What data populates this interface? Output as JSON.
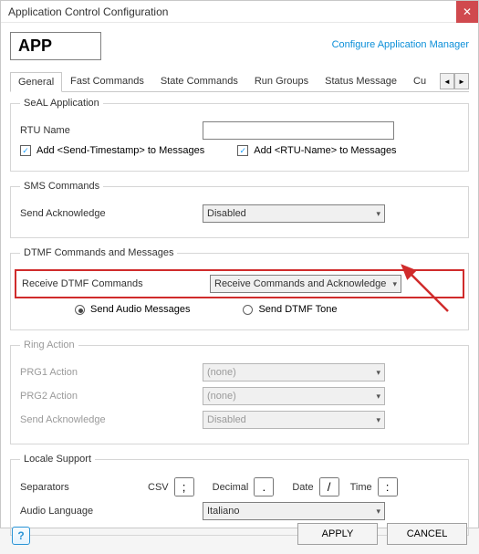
{
  "titlebar": {
    "title": "Application Control Configuration"
  },
  "top": {
    "app_code": "APP",
    "cfg_link": "Configure Application Manager"
  },
  "tabs": {
    "items": [
      "General",
      "Fast Commands",
      "State Commands",
      "Run Groups",
      "Status Message",
      "Cu"
    ],
    "active": 0
  },
  "seal": {
    "legend": "SeAL Application",
    "rtu_label": "RTU Name",
    "rtu_value": "",
    "add_ts_label": "Add <Send-Timestamp> to Messages",
    "add_ts_checked": true,
    "add_rtun_label": "Add <RTU-Name> to Messages",
    "add_rtun_checked": true
  },
  "sms": {
    "legend": "SMS Commands",
    "sendack_label": "Send Acknowledge",
    "sendack_value": "Disabled"
  },
  "dtmf": {
    "legend": "DTMF Commands and Messages",
    "recv_label": "Receive DTMF Commands",
    "recv_value": "Receive Commands and Acknowledge",
    "send_audio_label": "Send Audio Messages",
    "send_tone_label": "Send DTMF Tone"
  },
  "ring": {
    "legend": "Ring Action",
    "prg1_label": "PRG1 Action",
    "prg1_value": "(none)",
    "prg2_label": "PRG2  Action",
    "prg2_value": "(none)",
    "sendack_label": "Send Acknowledge",
    "sendack_value": "Disabled"
  },
  "locale": {
    "legend": "Locale Support",
    "sep_label": "Separators",
    "csv_label": "CSV",
    "csv_value": ";",
    "dec_label": "Decimal",
    "dec_value": ".",
    "date_label": "Date",
    "date_value": "/",
    "time_label": "Time",
    "time_value": ":",
    "audio_lang_label": "Audio Language",
    "audio_lang_value": "Italiano"
  },
  "buttons": {
    "apply": "APPLY",
    "cancel": "CANCEL"
  }
}
